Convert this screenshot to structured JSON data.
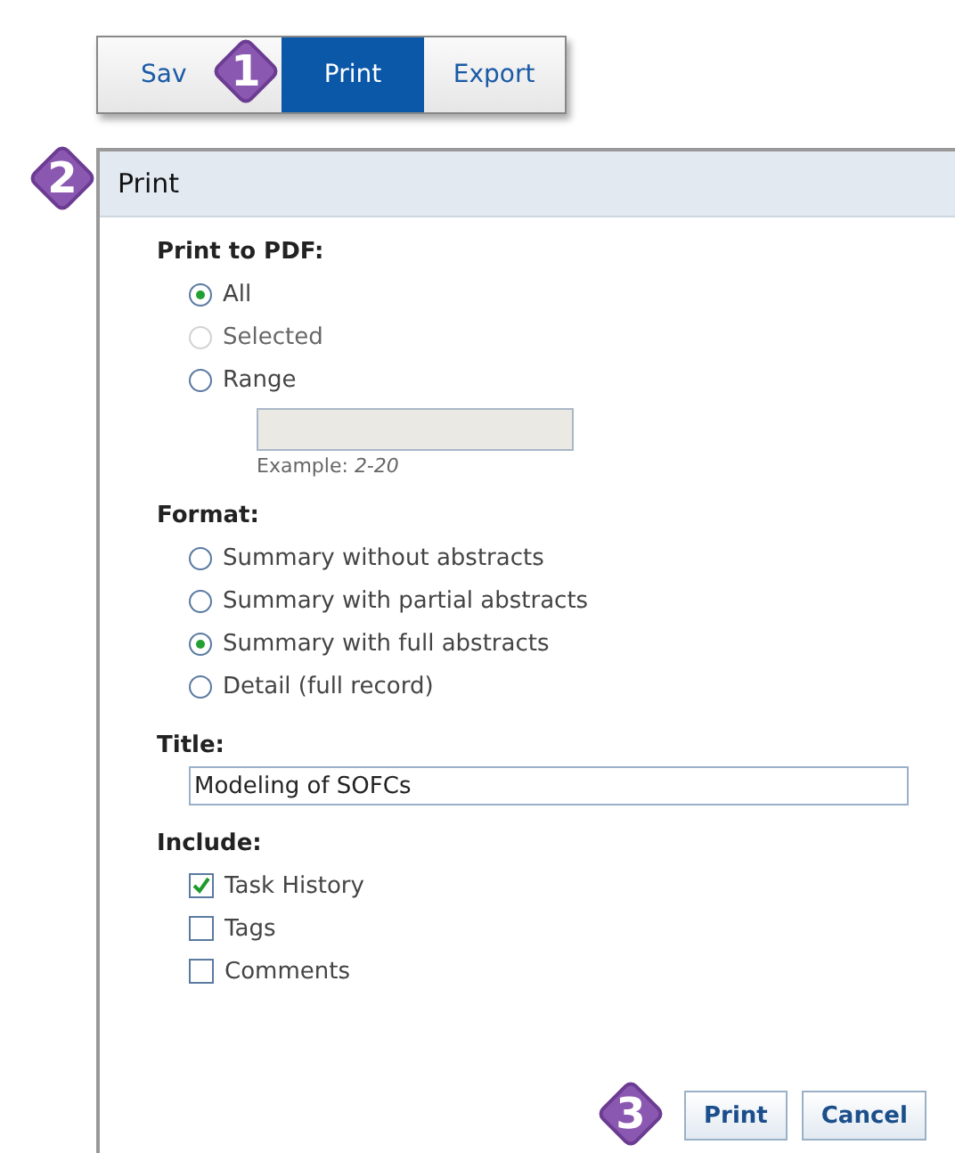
{
  "toolbar": [
    {
      "label": "Sav",
      "selected": false
    },
    {
      "label": "Print",
      "selected": true
    },
    {
      "label": "Export",
      "selected": false
    }
  ],
  "callouts": [
    "1",
    "2",
    "3"
  ],
  "panel": {
    "title": "Print",
    "print_to_pdf": {
      "label": "Print to PDF:",
      "options": [
        {
          "label": "All",
          "selected": true,
          "disabled": false
        },
        {
          "label": "Selected",
          "selected": false,
          "disabled": true
        },
        {
          "label": "Range",
          "selected": false,
          "disabled": false
        }
      ],
      "range_field": {
        "disabled": true
      },
      "example": "Example: *2-20*"
    },
    "format": {
      "label": "Format:",
      "options": [
        {
          "label": "Summary without abstracts",
          "selected": false
        },
        {
          "label": "Summary with partial abstracts",
          "selected": false
        },
        {
          "label": "Summary with full abstracts",
          "selected": true
        },
        {
          "label": "Detail (full record)",
          "selected": false
        }
      ]
    },
    "title_field": {
      "label": "Title:",
      "value": "Modeling of SOFCs"
    },
    "include": {
      "label": "Include:",
      "options": [
        {
          "label": "Task History",
          "checked": true
        },
        {
          "label": "Tags",
          "checked": false
        },
        {
          "label": "Comments",
          "checked": false
        }
      ]
    },
    "buttons": [
      "Print",
      "Cancel"
    ]
  }
}
